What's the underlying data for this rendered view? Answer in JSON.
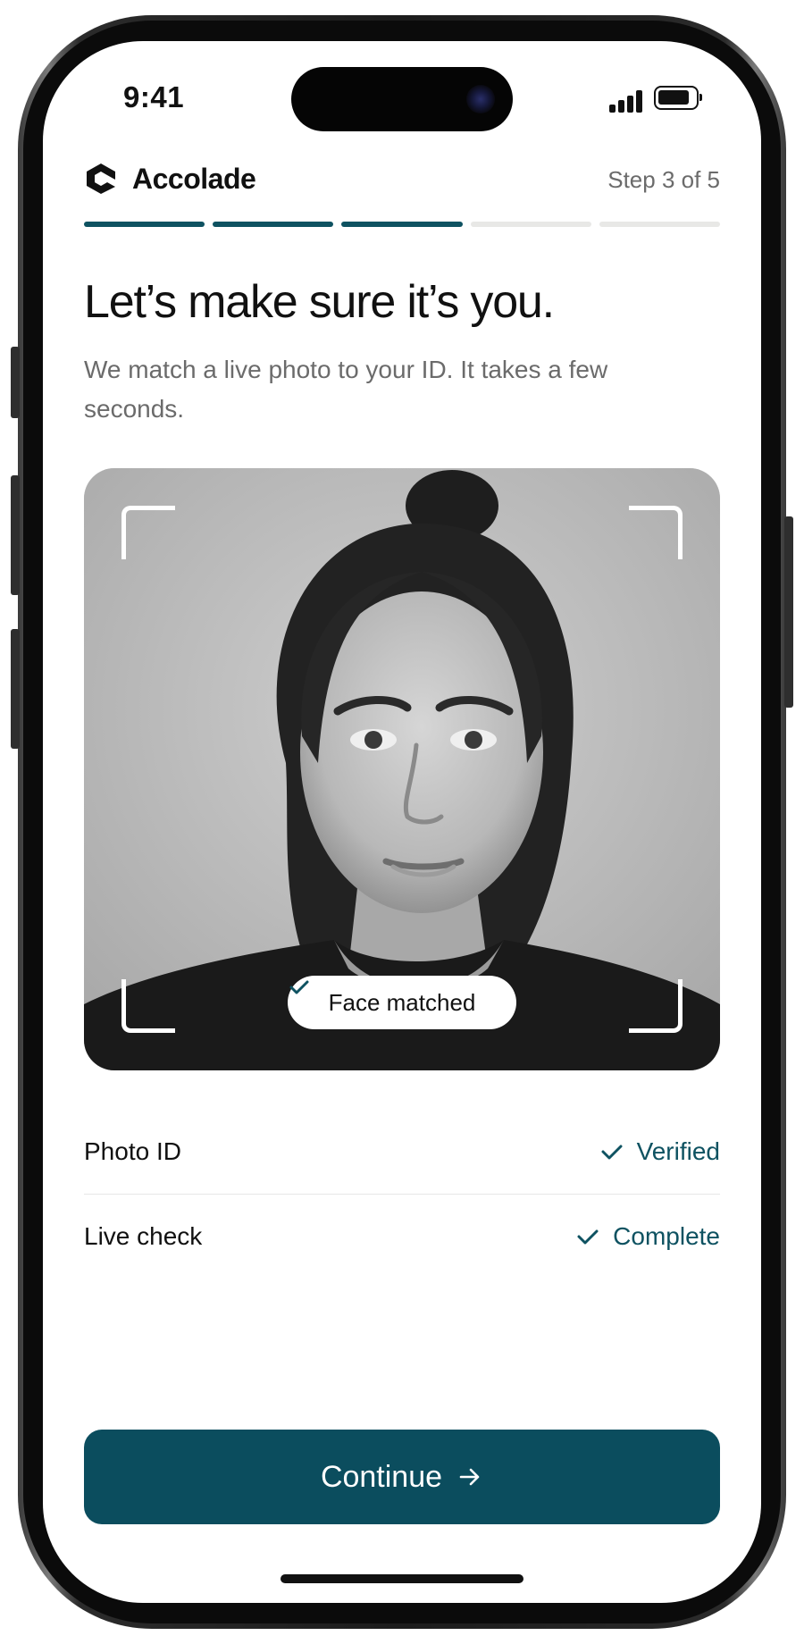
{
  "status_bar": {
    "time": "9:41",
    "signal_icon": "cellular-signal-icon",
    "battery_icon": "battery-icon"
  },
  "header": {
    "brand_name": "Accolade",
    "brand_icon": "accolade-logo-icon",
    "step_label": "Step 3 of 5",
    "progress": {
      "completed_steps": 3,
      "total_steps": 5
    }
  },
  "content": {
    "title": "Let’s make sure it’s you.",
    "subtitle": "We match a live photo to your ID. It takes a few seconds."
  },
  "photo_card": {
    "match_badge": "Face matched",
    "badge_icon": "checkmark-icon"
  },
  "checks": [
    {
      "label": "Photo ID",
      "status": "Verified",
      "icon": "checkmark-icon"
    },
    {
      "label": "Live check",
      "status": "Complete",
      "icon": "checkmark-icon"
    }
  ],
  "cta": {
    "label": "Continue",
    "icon": "arrow-right-icon"
  },
  "colors": {
    "accent": "#0e5261",
    "button": "#0b4d5e",
    "muted_text": "#6b6b6b",
    "progress_inactive": "#e8e8e6"
  }
}
